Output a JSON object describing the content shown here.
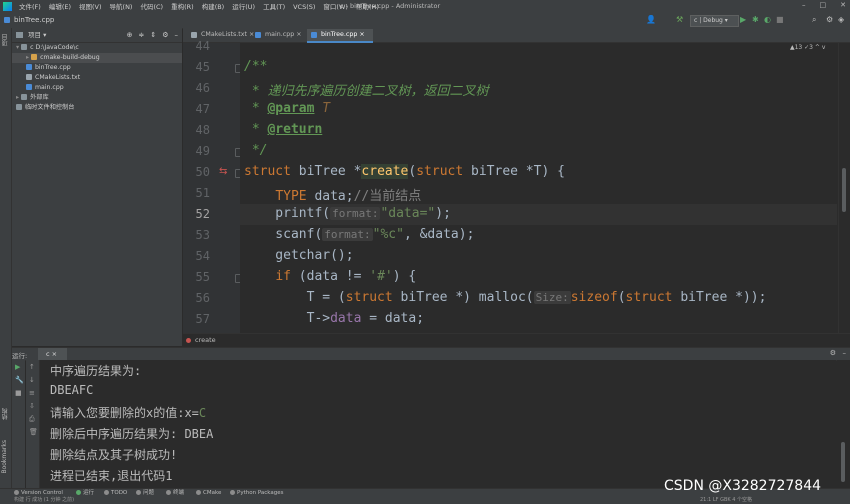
{
  "titlebar": {
    "menu": [
      "文件(F)",
      "编辑(E)",
      "视图(V)",
      "导航(N)",
      "代码(C)",
      "重构(R)",
      "构建(B)",
      "运行(U)",
      "工具(T)",
      "VCS(S)",
      "窗口(W)",
      "帮助(H)"
    ],
    "title": "c - biniTree.cpp - Administrator",
    "win_min": "–",
    "win_max": "□",
    "win_close": "✕"
  },
  "navbar": {
    "breadcrumb": "binTree.cpp",
    "run_config": "c | Debug ▾"
  },
  "leftstrip": {
    "project": "项目",
    "structure": "结构",
    "bookmarks": "Bookmarks"
  },
  "project": {
    "header": "项目 ▾",
    "items": [
      {
        "label": "c  D:\\JavaCode\\c",
        "depth": 0
      },
      {
        "label": "cmake-build-debug",
        "depth": 1
      },
      {
        "label": "binTree.cpp",
        "depth": 1
      },
      {
        "label": "CMakeLists.txt",
        "depth": 1
      },
      {
        "label": "main.cpp",
        "depth": 1
      },
      {
        "label": "外部库",
        "depth": 0
      },
      {
        "label": "临时文件和控制台",
        "depth": 0
      }
    ]
  },
  "tabs": [
    {
      "label": "CMakeLists.txt ×"
    },
    {
      "label": "main.cpp ×"
    },
    {
      "label": "binTree.cpp ×"
    }
  ],
  "inspect": "▲13  ✓3  ^  v",
  "editor": {
    "lines": [
      {
        "n": "44",
        "html": ""
      },
      {
        "n": "45",
        "html": "<span class=\"doc\">/**</span>"
      },
      {
        "n": "46",
        "html": "<span class=\"doc\"> * 递归先序遍历创建二叉树，返回二叉树</span>"
      },
      {
        "n": "47",
        "html": "<span class=\"doc\"> * </span><span class=\"tag\">@param</span><span class=\"dparam\"> T</span>"
      },
      {
        "n": "48",
        "html": "<span class=\"doc\"> * </span><span class=\"tag\">@return</span>"
      },
      {
        "n": "49",
        "html": "<span class=\"doc\"> */</span>"
      },
      {
        "n": "50",
        "html": "<span class=\"kw\">struct</span> biTree *<span class=\"fnh\">create</span>(<span class=\"kw\">struct</span> biTree *T) {"
      },
      {
        "n": "51",
        "html": "    <span class=\"kw\">TYPE</span> data;<span class=\"cmt\">//当前结点</span>"
      },
      {
        "n": "52",
        "html": "    printf(<span class=\"hint\">format:</span><span class=\"str\">\"data=\"</span>);"
      },
      {
        "n": "53",
        "html": "    scanf(<span class=\"hint\">format:</span><span class=\"str\">\"%c\"</span>, &amp;data);"
      },
      {
        "n": "54",
        "html": "    getchar();"
      },
      {
        "n": "55",
        "html": "    <span class=\"kw\">if</span> (data != <span class=\"str\">'#'</span>) {"
      },
      {
        "n": "56",
        "html": "        T = (<span class=\"kw\">struct</span> biTree *) malloc(<span class=\"hint\">Size:</span><span class=\"kw\">sizeof</span>(<span class=\"kw\">struct</span> biTree *));"
      },
      {
        "n": "57",
        "html": "        T-><span class=\"field\">data</span> = data;"
      }
    ]
  },
  "crumb": "create",
  "run": {
    "label": "运行:",
    "tab": "c ×"
  },
  "console": {
    "lines": [
      {
        "text": "中序遍历结果为:",
        "input": ""
      },
      {
        "text": "DBEAFC",
        "input": ""
      },
      {
        "text": "请输入您要删除的x的值:x=",
        "input": "C"
      },
      {
        "text": "删除后中序遍历结果为: DBEA",
        "input": ""
      },
      {
        "text": "删除结点及其子树成功!",
        "input": ""
      },
      {
        "text": "进程已结束,退出代码1",
        "input": ""
      }
    ]
  },
  "bottombar": [
    "Version Control",
    "运行",
    "TODO",
    "问题",
    "终端",
    "CMake",
    "Python Packages"
  ],
  "statusbar": {
    "left": "构建 行 成功 (1 分钟 之前)",
    "right": "21:1  LF  GBK  4 个空格"
  },
  "watermark": "CSDN @X3282727844"
}
